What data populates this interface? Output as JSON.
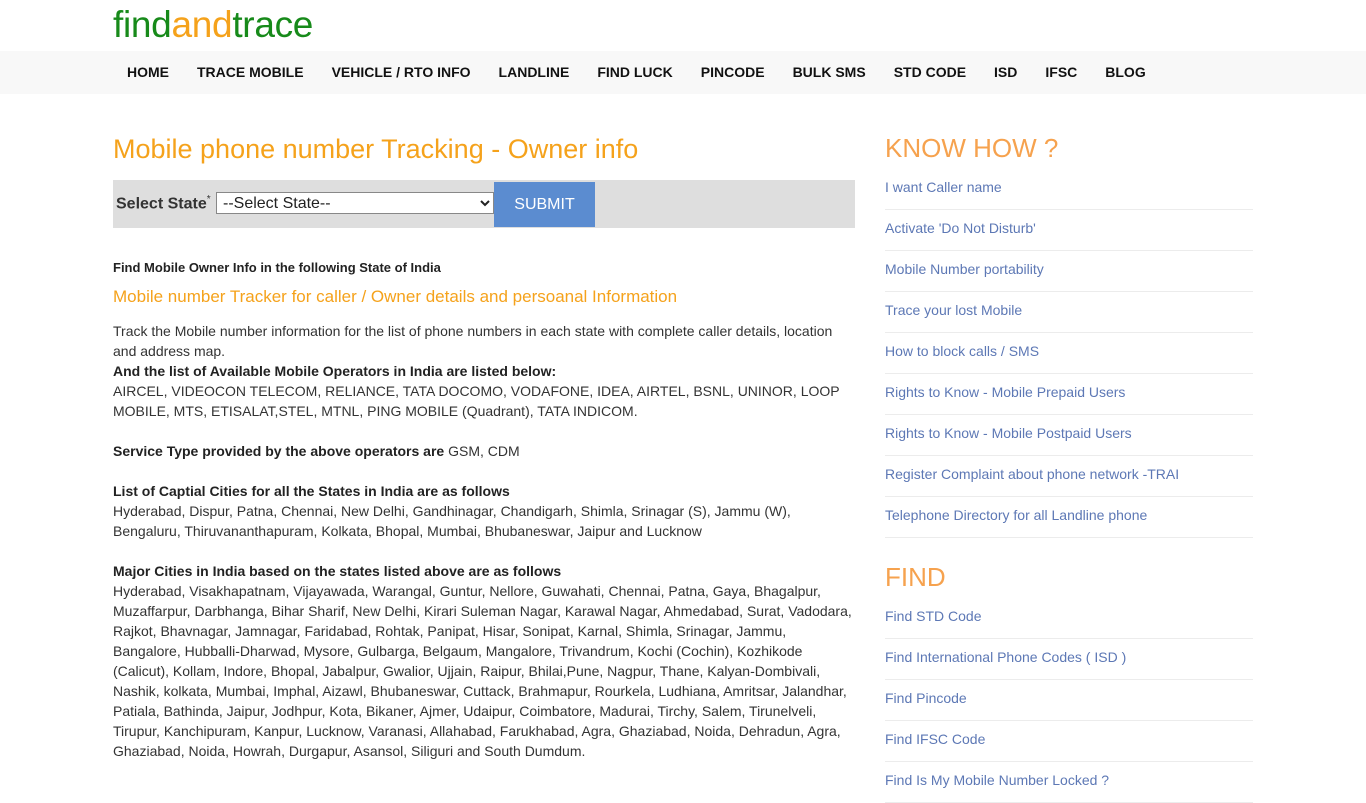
{
  "logo": {
    "part1": "find",
    "part2": "and",
    "part3": "trace"
  },
  "nav": [
    "HOME",
    "TRACE MOBILE",
    "VEHICLE / RTO INFO",
    "LANDLINE",
    "FIND LUCK",
    "PINCODE",
    "BULK SMS",
    "STD CODE",
    "ISD",
    "IFSC",
    "BLOG"
  ],
  "main": {
    "title": "Mobile phone number Tracking - Owner info",
    "form": {
      "label": "Select State",
      "required_mark": "*",
      "select_value": "--Select State--",
      "submit": "SUBMIT"
    },
    "heading": "Find Mobile Owner Info in the following State of India",
    "subheading": "Mobile number Tracker for caller / Owner details and persoanal Information",
    "intro": "Track the Mobile number information for the list of phone numbers in each state with complete caller details, location and address map.",
    "operators_heading": "And the list of Available Mobile Operators in India are listed below:",
    "operators": "AIRCEL, VIDEOCON TELECOM, RELIANCE, TATA DOCOMO, VODAFONE, IDEA, AIRTEL, BSNL, UNINOR, LOOP MOBILE, MTS, ETISALAT,STEL, MTNL, PING MOBILE (Quadrant), TATA INDICOM.",
    "service_label": "Service Type provided by the above operators are",
    "service_value": " GSM, CDM",
    "capitals_heading": "List of Captial Cities for all the States in India are as follows",
    "capitals": "Hyderabad, Dispur, Patna, Chennai, New Delhi, Gandhinagar, Chandigarh, Shimla, Srinagar (S), Jammu (W), Bengaluru, Thiruvananthapuram, Kolkata, Bhopal, Mumbai, Bhubaneswar, Jaipur and Lucknow",
    "cities_heading": "Major Cities in India based on the states listed above are as follows",
    "cities": "Hyderabad, Visakhapatnam, Vijayawada, Warangal, Guntur, Nellore, Guwahati, Chennai, Patna, Gaya, Bhagalpur, Muzaffarpur, Darbhanga, Bihar Sharif, New Delhi, Kirari Suleman Nagar, Karawal Nagar, Ahmedabad, Surat, Vadodara, Rajkot, Bhavnagar, Jamnagar, Faridabad, Rohtak, Panipat, Hisar, Sonipat, Karnal, Shimla, Srinagar, Jammu, Bangalore, Hubballi-Dharwad, Mysore, Gulbarga, Belgaum, Mangalore, Trivandrum, Kochi (Cochin), Kozhikode (Calicut), Kollam, Indore, Bhopal, Jabalpur, Gwalior, Ujjain, Raipur, Bhilai,Pune, Nagpur, Thane, Kalyan-Dombivali, Nashik, kolkata, Mumbai, Imphal, Aizawl, Bhubaneswar, Cuttack, Brahmapur, Rourkela, Ludhiana, Amritsar, Jalandhar, Patiala, Bathinda, Jaipur, Jodhpur, Kota, Bikaner, Ajmer, Udaipur, Coimbatore, Madurai, Tirchy, Salem, Tirunelveli, Tirupur, Kanchipuram, Kanpur, Lucknow, Varanasi, Allahabad, Farukhabad, Agra, Ghaziabad, Noida, Dehradun, Agra, Ghaziabad, Noida, Howrah, Durgapur, Asansol, Siliguri and South Dumdum."
  },
  "sidebar": {
    "know_how_title": "KNOW HOW ?",
    "know_how": [
      "I want Caller name",
      "Activate 'Do Not Disturb'",
      "Mobile Number portability",
      "Trace your lost Mobile",
      "How to block calls / SMS",
      "Rights to Know - Mobile Prepaid Users",
      "Rights to Know - Mobile Postpaid Users",
      "Register Complaint about phone network -TRAI",
      "Telephone Directory for all Landline phone"
    ],
    "find_title": "FIND",
    "find": [
      "Find STD Code",
      "Find International Phone Codes ( ISD )",
      "Find Pincode",
      "Find IFSC Code",
      "Find Is My Mobile Number Locked ?"
    ]
  }
}
